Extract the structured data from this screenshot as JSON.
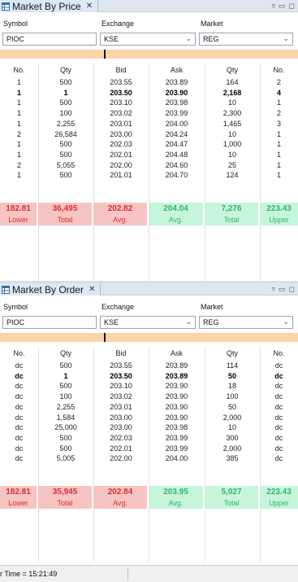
{
  "panels": [
    {
      "title": "Market By Price",
      "labels": {
        "symbol": "Symbol",
        "exchange": "Exchange",
        "market": "Market"
      },
      "values": {
        "symbol": "PIOC",
        "exchange": "KSE",
        "market": "REG"
      },
      "headers": [
        "No.",
        "Qty",
        "Bid",
        "Ask",
        "Qty",
        "No."
      ],
      "rows": [
        [
          "1",
          "500",
          "203.55",
          "203.89",
          "164",
          "2"
        ],
        [
          "1",
          "1",
          "203.50",
          "203.90",
          "2,168",
          "4"
        ],
        [
          "1",
          "500",
          "203.10",
          "203.98",
          "10",
          "1"
        ],
        [
          "1",
          "100",
          "203.02",
          "203.99",
          "2,300",
          "2"
        ],
        [
          "1",
          "2,255",
          "203.01",
          "204.00",
          "1,465",
          "3"
        ],
        [
          "2",
          "26,584",
          "203.00",
          "204.24",
          "10",
          "1"
        ],
        [
          "1",
          "500",
          "202.03",
          "204.47",
          "1,000",
          "1"
        ],
        [
          "1",
          "500",
          "202.01",
          "204.48",
          "10",
          "1"
        ],
        [
          "2",
          "5,055",
          "202.00",
          "204.60",
          "25",
          "1"
        ],
        [
          "1",
          "500",
          "201.01",
          "204.70",
          "124",
          "1"
        ]
      ],
      "bold_row": 1,
      "summary": [
        {
          "value": "182.81",
          "label": "Lower"
        },
        {
          "value": "36,495",
          "label": "Total"
        },
        {
          "value": "202.82",
          "label": "Avg."
        },
        {
          "value": "204.04",
          "label": "Avg."
        },
        {
          "value": "7,276",
          "label": "Total"
        },
        {
          "value": "223.43",
          "label": "Upper"
        }
      ]
    },
    {
      "title": "Market By Order",
      "labels": {
        "symbol": "Symbol",
        "exchange": "Exchange",
        "market": "Market"
      },
      "values": {
        "symbol": "PIOC",
        "exchange": "KSE",
        "market": "REG"
      },
      "headers": [
        "No.",
        "Qty",
        "Bid",
        "Ask",
        "Qty",
        "No."
      ],
      "rows": [
        [
          "dc",
          "500",
          "203.55",
          "203.89",
          "114",
          "dc"
        ],
        [
          "dc",
          "1",
          "203.50",
          "203.89",
          "50",
          "dc"
        ],
        [
          "dc",
          "500",
          "203.10",
          "203.90",
          "18",
          "dc"
        ],
        [
          "dc",
          "100",
          "203.02",
          "203.90",
          "100",
          "dc"
        ],
        [
          "dc",
          "2,255",
          "203.01",
          "203.90",
          "50",
          "dc"
        ],
        [
          "dc",
          "1,584",
          "203.00",
          "203.90",
          "2,000",
          "dc"
        ],
        [
          "dc",
          "25,000",
          "203.00",
          "203.98",
          "10",
          "dc"
        ],
        [
          "dc",
          "500",
          "202.03",
          "203.99",
          "300",
          "dc"
        ],
        [
          "dc",
          "500",
          "202.01",
          "203.99",
          "2,000",
          "dc"
        ],
        [
          "dc",
          "5,005",
          "202.00",
          "204.00",
          "385",
          "dc"
        ]
      ],
      "bold_row": 1,
      "summary": [
        {
          "value": "182.81",
          "label": "Lower"
        },
        {
          "value": "35,945",
          "label": "Total"
        },
        {
          "value": "202.84",
          "label": "Avg."
        },
        {
          "value": "203.95",
          "label": "Avg."
        },
        {
          "value": "5,027",
          "label": "Total"
        },
        {
          "value": "223.43",
          "label": "Upper"
        }
      ]
    }
  ],
  "status_bar": {
    "text": "r Time = 15:21:49"
  },
  "icons": {
    "tab_icon": "market-table-icon",
    "close": "close-icon",
    "minimize": "minimize-icon",
    "maximize": "maximize-icon",
    "dropdown": "chevron-down-icon",
    "view_menu": "view-menu-icon"
  },
  "colors": {
    "lower_bg": "#f7c4c4",
    "lower_fg": "#d93030",
    "upper_bg": "#c6f5dc",
    "upper_fg": "#33b56b",
    "orange_bar": "#fbd5a8"
  }
}
